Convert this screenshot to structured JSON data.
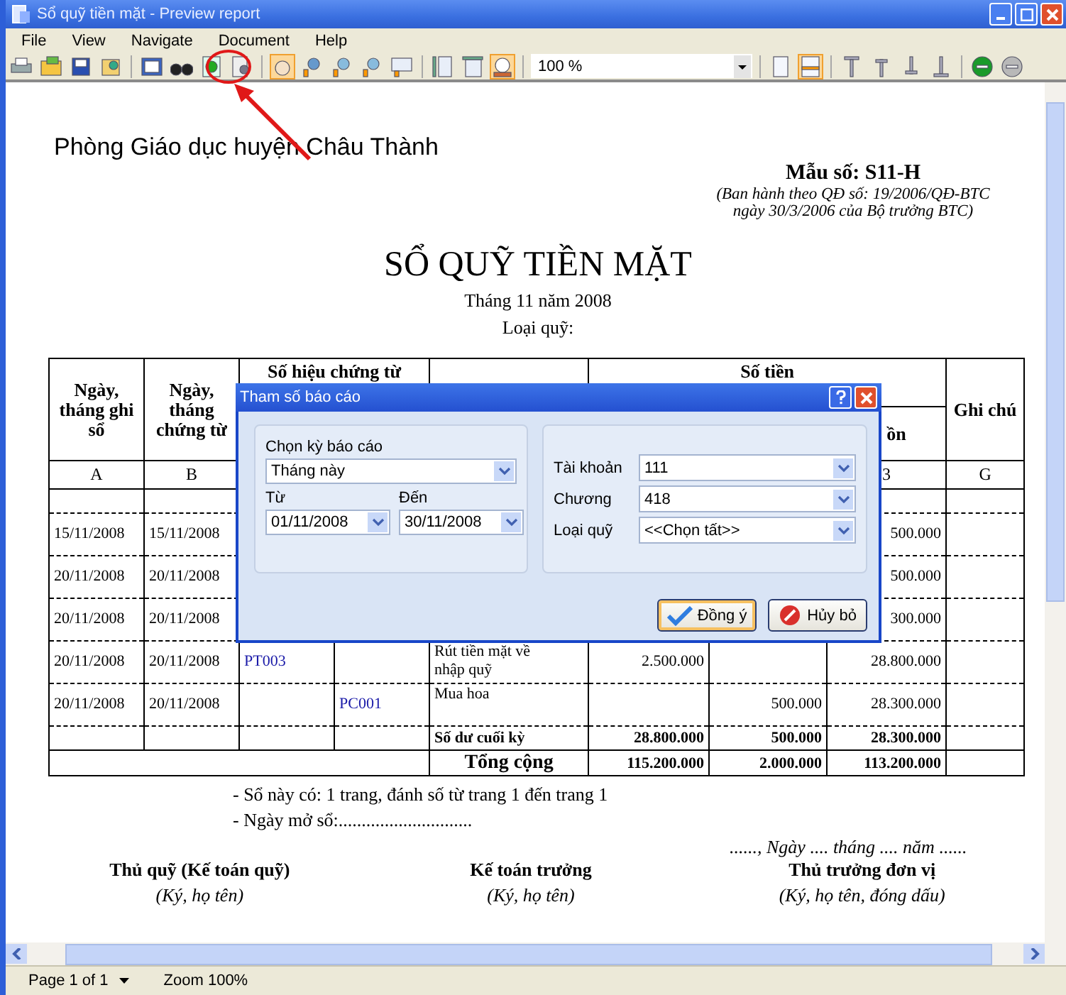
{
  "window": {
    "title": "Sổ quỹ tiền mặt - Preview report"
  },
  "menu": [
    "File",
    "View",
    "Navigate",
    "Document",
    "Help"
  ],
  "toolbar": {
    "zoom": "100 %"
  },
  "report": {
    "organization": "Phòng Giáo dục huyện Châu Thành",
    "form_number": "Mẫu số: S11-H",
    "form_note": [
      "(Ban hành theo QĐ số: 19/2006/QĐ-BTC",
      "ngày 30/3/2006 của Bộ trưởng BTC)"
    ],
    "title": "SỔ QUỸ TIỀN MẶT",
    "period": "Tháng 11 năm 2008",
    "fund_type": "Loại quỹ:",
    "table": {
      "headers": {
        "date_recorded": "Ngày, tháng ghi sổ",
        "date_voucher": "Ngày, tháng chứng từ",
        "voucher_no": "Số hiệu chứng từ",
        "amount": "Số tiền",
        "balance": "ồn",
        "note": "Ghi chú"
      },
      "letters": {
        "column_1": "A",
        "column_2": "B",
        "column_8": "3",
        "column_9": "G"
      },
      "rows": [
        {
          "kind": "opening"
        },
        {
          "kind": "entry",
          "column_1": "15/11/2008",
          "column_2": "15/11/2008",
          "column_8": "500.000"
        },
        {
          "kind": "entry",
          "column_1": "20/11/2008",
          "column_2": "20/11/2008",
          "column_8": "500.000"
        },
        {
          "kind": "entry",
          "column_1": "20/11/2008",
          "column_2": "20/11/2008",
          "column_8": "300.000"
        },
        {
          "kind": "entry",
          "column_1": "20/11/2008",
          "column_2": "20/11/2008",
          "column_3": "PT003",
          "column_5": "Rút tiền mặt về nhập quỹ",
          "column_6": "2.500.000",
          "column_8": "28.800.000"
        },
        {
          "kind": "entry",
          "column_1": "20/11/2008",
          "column_2": "20/11/2008",
          "column_4": "PC001",
          "column_5": "Mua hoa",
          "column_7": "500.000",
          "column_8": "28.300.000"
        },
        {
          "kind": "closing",
          "column_5": "Số dư cuối kỳ",
          "column_6": "28.800.000",
          "column_7": "500.000",
          "column_8": "28.300.000"
        }
      ],
      "total": {
        "label": "Tổng cộng",
        "values": [
          "115.200.000",
          "2.000.000",
          "113.200.000"
        ]
      }
    },
    "notes": [
      "- Sổ này có: 1 trang, đánh số từ trang 1 đến trang 1",
      "- Ngày mở sổ:............................."
    ],
    "date_line": "......, Ngày .... tháng .... năm ......",
    "signatures": [
      {
        "title": "Thủ quỹ (Kế toán quỹ)",
        "note": "(Ký, họ tên)"
      },
      {
        "title": "Kế toán trưởng",
        "note": "(Ký, họ tên)"
      },
      {
        "title": "Thủ trưởng đơn vị",
        "note": "(Ký, họ tên, đóng dấu)"
      }
    ]
  },
  "dialog": {
    "title": "Tham số báo cáo",
    "period_label": "Chọn kỳ báo cáo",
    "period": "Tháng này",
    "from_label": "Từ",
    "from": "01/11/2008",
    "to_label": "Đến",
    "to": "30/11/2008",
    "fields": [
      {
        "label": "Tài khoản",
        "value": "111"
      },
      {
        "label": "Chương",
        "value": "418"
      },
      {
        "label": "Loại quỹ",
        "value": "<<Chọn tất>>"
      }
    ],
    "buttons": [
      {
        "label": "Đồng ý",
        "kind": "ok"
      },
      {
        "label": "Hủy bỏ",
        "kind": "cancel"
      }
    ]
  },
  "status_bar": {
    "page": "Page 1 of 1",
    "zoom": "Zoom 100%"
  }
}
